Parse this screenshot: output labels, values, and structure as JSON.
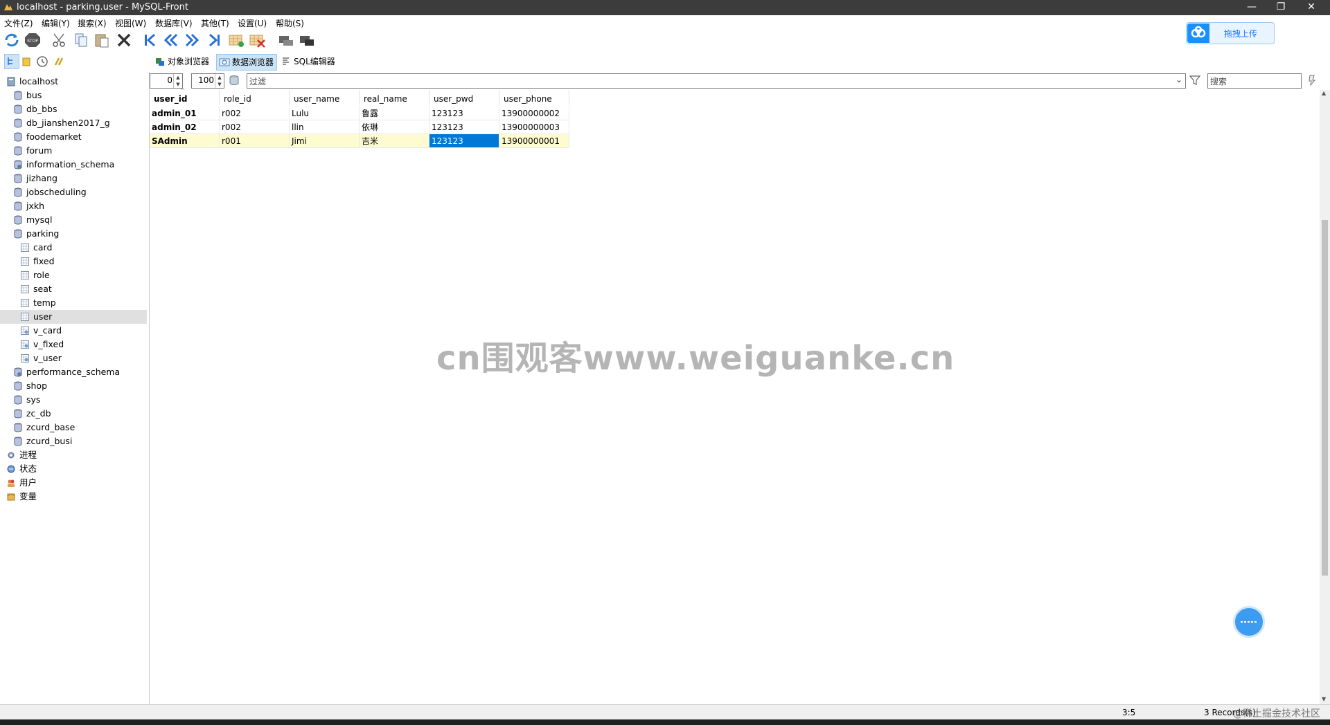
{
  "window": {
    "title": "localhost - parking.user - MySQL-Front"
  },
  "menu": [
    "文件(Z)",
    "编辑(Y)",
    "搜索(X)",
    "视图(W)",
    "数据库(V)",
    "其他(T)",
    "设置(U)",
    "帮助(S)"
  ],
  "cloud_button": {
    "label": "拖拽上传"
  },
  "view_tabs": [
    {
      "label": "对象浏览器",
      "active": false
    },
    {
      "label": "数据浏览器",
      "active": true
    },
    {
      "label": "SQL编辑器",
      "active": false
    }
  ],
  "tree": [
    {
      "label": "localhost",
      "level": 0,
      "type": "server"
    },
    {
      "label": "bus",
      "level": 1,
      "type": "db"
    },
    {
      "label": "db_bbs",
      "level": 1,
      "type": "db"
    },
    {
      "label": "db_jianshen2017_g",
      "level": 1,
      "type": "db"
    },
    {
      "label": "foodemarket",
      "level": 1,
      "type": "db"
    },
    {
      "label": "forum",
      "level": 1,
      "type": "db"
    },
    {
      "label": "information_schema",
      "level": 1,
      "type": "sysdb"
    },
    {
      "label": "jizhang",
      "level": 1,
      "type": "db"
    },
    {
      "label": "jobscheduling",
      "level": 1,
      "type": "db"
    },
    {
      "label": "jxkh",
      "level": 1,
      "type": "db"
    },
    {
      "label": "mysql",
      "level": 1,
      "type": "db"
    },
    {
      "label": "parking",
      "level": 1,
      "type": "db"
    },
    {
      "label": "card",
      "level": 2,
      "type": "table"
    },
    {
      "label": "fixed",
      "level": 2,
      "type": "table"
    },
    {
      "label": "role",
      "level": 2,
      "type": "table"
    },
    {
      "label": "seat",
      "level": 2,
      "type": "table"
    },
    {
      "label": "temp",
      "level": 2,
      "type": "table"
    },
    {
      "label": "user",
      "level": 2,
      "type": "table",
      "selected": true
    },
    {
      "label": "v_card",
      "level": 2,
      "type": "view"
    },
    {
      "label": "v_fixed",
      "level": 2,
      "type": "view"
    },
    {
      "label": "v_user",
      "level": 2,
      "type": "view"
    },
    {
      "label": "performance_schema",
      "level": 1,
      "type": "sysdb"
    },
    {
      "label": "shop",
      "level": 1,
      "type": "db"
    },
    {
      "label": "sys",
      "level": 1,
      "type": "db"
    },
    {
      "label": "zc_db",
      "level": 1,
      "type": "db"
    },
    {
      "label": "zcurd_base",
      "level": 1,
      "type": "db"
    },
    {
      "label": "zcurd_busi",
      "level": 1,
      "type": "db"
    },
    {
      "label": "进程",
      "level": 0,
      "type": "process"
    },
    {
      "label": "状态",
      "level": 0,
      "type": "status"
    },
    {
      "label": "用户",
      "level": 0,
      "type": "users"
    },
    {
      "label": "变量",
      "level": 0,
      "type": "variables"
    }
  ],
  "filter": {
    "offset": "0",
    "limit": "100",
    "filter_placeholder": "过滤",
    "search_placeholder": "搜索"
  },
  "grid": {
    "columns": [
      "user_id",
      "role_id",
      "user_name",
      "real_name",
      "user_pwd",
      "user_phone"
    ],
    "rows": [
      [
        "admin_01",
        "r002",
        "Lulu",
        "鲁露",
        "123123",
        "13900000002"
      ],
      [
        "admin_02",
        "r002",
        "llin",
        "依琳",
        "123123",
        "13900000003"
      ],
      [
        "SAdmin",
        "r001",
        "Jimi",
        "吉米",
        "123123",
        "13900000001"
      ]
    ],
    "selected_row": 2,
    "selected_col": 4
  },
  "status": {
    "position": "3:5",
    "records": "3 Records(s)",
    "overlay": "@稀土掘金技术社区"
  },
  "watermark": "cn围观客www.weiguanke.cn",
  "colors": {
    "titlebar": "#3c3c3c",
    "selection": "#0078d7",
    "current_row": "#fffbd0",
    "accent": "#1890ff"
  }
}
